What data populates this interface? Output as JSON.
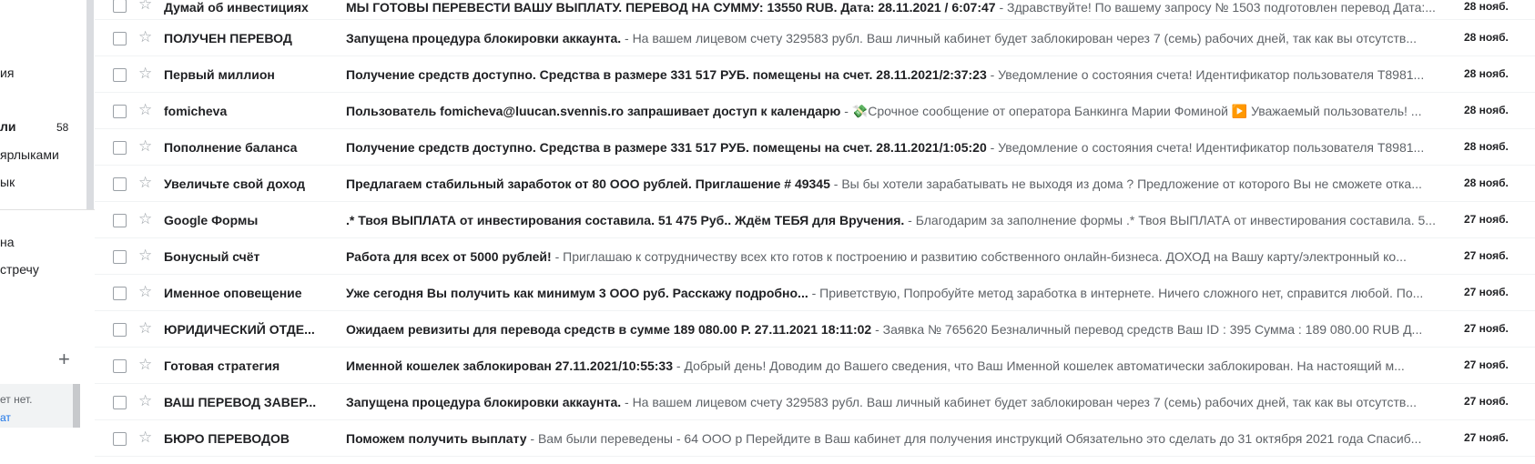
{
  "sidebar": {
    "items": [
      {
        "label": "ия",
        "count": ""
      },
      {
        "label": "ли",
        "count": "58",
        "bold": true
      },
      {
        "label": "ярлыками",
        "count": ""
      },
      {
        "label": "ык",
        "count": ""
      },
      {
        "label": "на",
        "count": ""
      },
      {
        "label": "стречу",
        "count": ""
      }
    ],
    "add_label": "+",
    "notice_text": "ет нет.",
    "notice_link": "ат"
  },
  "emails": [
    {
      "sender": "Думай об инвестициях",
      "subject": "МЫ ГОТОВЫ ПЕРЕВЕСТИ ВАШУ ВЫПЛАТУ. ПЕРЕВОД НА СУММУ: 13550 RUB. Дата: 28.11.2021 / 6:07:47",
      "snippet": " - Здравствуйте! По вашему запросу № 1503 подготовлен перевод Дата:...",
      "date": "28 нояб."
    },
    {
      "sender": "ПОЛУЧЕН ПЕРЕВОД",
      "subject": "Запущена процедура блокировки аккаунта.",
      "snippet": " - На вашем лицевом счету 329583 рубл. Ваш личный кабинет будет заблокирован через 7 (семь) рабочих дней, так как вы отсутств...",
      "date": "28 нояб."
    },
    {
      "sender": "Первый миллион",
      "subject": "Получение средств доступно. Средства в размере 331 517 РУБ. помещены на счет. 28.11.2021/2:37:23",
      "snippet": " - Уведомление о состояния счета! Идентификатор пользователя T8981...",
      "date": "28 нояб."
    },
    {
      "sender": "fomicheva",
      "subject": "Пользователь fomicheva@luucan.svennis.ro запрашивает доступ к календарю",
      "snippet": " - 💸Срочное сообщение от оператора Банкинга Марии Фоминой ▶️ Уважаемый пользователь! ...",
      "date": "28 нояб."
    },
    {
      "sender": "Пополнение баланса",
      "subject": "Получение средств доступно. Средства в размере 331 517 РУБ. помещены на счет. 28.11.2021/1:05:20",
      "snippet": " - Уведомление о состояния счета! Идентификатор пользователя T8981...",
      "date": "28 нояб."
    },
    {
      "sender": "Увеличьте свой доход",
      "subject": "Предлагаем стабильный заработок от 80 ООО рублей. Приглашение # 49345",
      "snippet": " - Вы бы хотели зарабатывать не выходя из дома ? Предложение от которого Вы не сможете отка...",
      "date": "28 нояб."
    },
    {
      "sender": "Google Формы",
      "subject": ".* Твоя ВЫПЛАТА от инвестирования составила. 51 475 Руб.. Ждём ТЕБЯ для Вручения.",
      "snippet": " - Благодарим за заполнение формы .* Твоя ВЫПЛАТА от инвестирования составила. 5...",
      "date": "27 нояб."
    },
    {
      "sender": "Бонусный счёт",
      "subject": "Работа для всех от 5000 рублей!",
      "snippet": " - Приглашаю к сотрудничеству всех кто готов к построению и развитию собственного онлайн-бизнеса. ДОХОД на Вашу карту/электронный ко...",
      "date": "27 нояб."
    },
    {
      "sender": "Именное оповещение",
      "subject": "Уже сегодня Вы получить как минимум 3 ООО руб. Расскажу подробно...",
      "snippet": " - Приветствую, Попробуйте метод заработка в интернете. Ничего сложного нет, справится любой. По...",
      "date": "27 нояб."
    },
    {
      "sender": "ЮРИДИЧЕСКИЙ ОТДЕ...",
      "subject": "Ожидаем ревизиты для перевода средств в сумме 189 080.00 Р. 27.11.2021 18:11:02",
      "snippet": " - Заявка № 765620 Безналичный перевод средств Ваш ID : 395 Сумма : 189 080.00 RUB Д...",
      "date": "27 нояб."
    },
    {
      "sender": "Готовая стратегия",
      "subject": "Именной кошелек заблокирован 27.11.2021/10:55:33",
      "snippet": " - Добрый день! Доводим до Вашего сведения, что Ваш Именной кошелек автоматически заблокирован. На настоящий м...",
      "date": "27 нояб."
    },
    {
      "sender": "ВАШ ПЕРЕВОД ЗАВЕР...",
      "subject": "Запущена процедура блокировки аккаунта.",
      "snippet": " - На вашем лицевом счету 329583 рубл. Ваш личный кабинет будет заблокирован через 7 (семь) рабочих дней, так как вы отсутств...",
      "date": "27 нояб."
    },
    {
      "sender": "БЮРО ПЕРЕВОДОВ",
      "subject": "Поможем получить выплату",
      "snippet": " - Вам были переведены - 64 ООО р Перейдите в Ваш кабинет для получения инструкций Обязательно это сделать до 31 октября 2021 года Спасиб...",
      "date": "27 нояб."
    }
  ]
}
